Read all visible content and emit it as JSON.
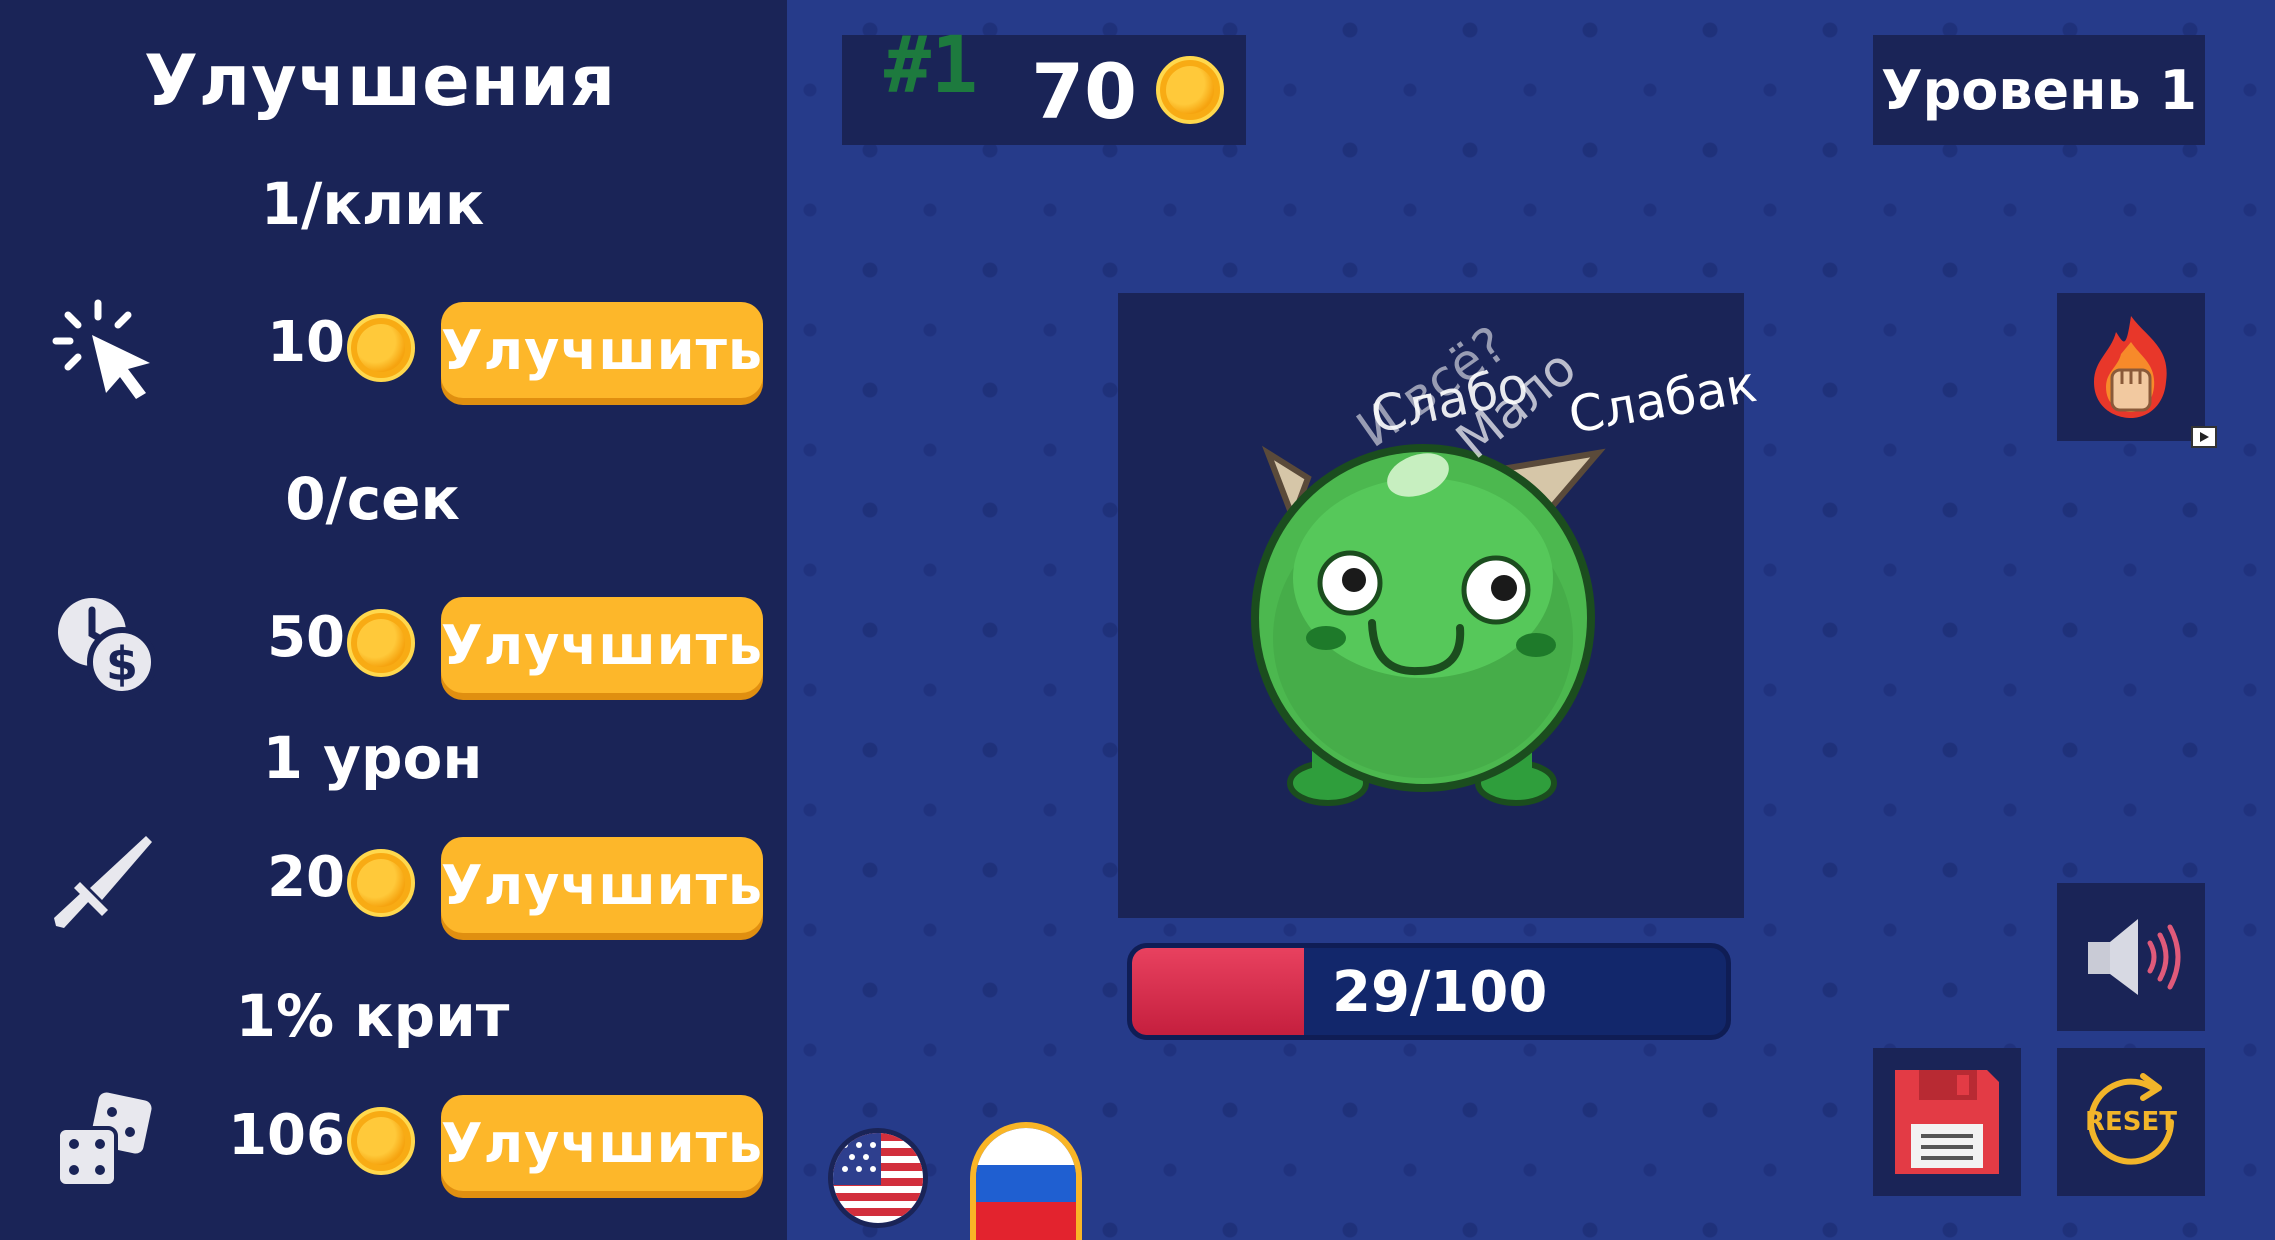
{
  "upgrades": {
    "title": "Улучшения",
    "items": [
      {
        "stat": "1/клик",
        "price": "10",
        "button": "Улучшить",
        "icon": "click-cursor-icon"
      },
      {
        "stat": "0/сек",
        "price": "50",
        "button": "Улучшить",
        "icon": "clock-dollar-icon"
      },
      {
        "stat": "1 урон",
        "price": "20",
        "button": "Улучшить",
        "icon": "sword-icon"
      },
      {
        "stat": "1% крит",
        "price": "106",
        "button": "Улучшить",
        "icon": "dice-icon"
      }
    ]
  },
  "header": {
    "rank": "#1",
    "money": "70",
    "level": "Уровень 1"
  },
  "monster": {
    "taunts": [
      "И всё?",
      "Слабо",
      "Мало",
      "Слабак"
    ],
    "hp_text": "29/100",
    "hp_fraction": 0.29
  },
  "controls": {
    "reset_label": "RESET",
    "boost_icon": "fire-fist-icon",
    "sound_icon": "speaker-icon",
    "save_icon": "floppy-disk-icon",
    "languages": [
      "en",
      "ru"
    ]
  },
  "colors": {
    "accent": "#fdb72a",
    "panel": "#1a2457",
    "hp": "#d92d4c"
  }
}
